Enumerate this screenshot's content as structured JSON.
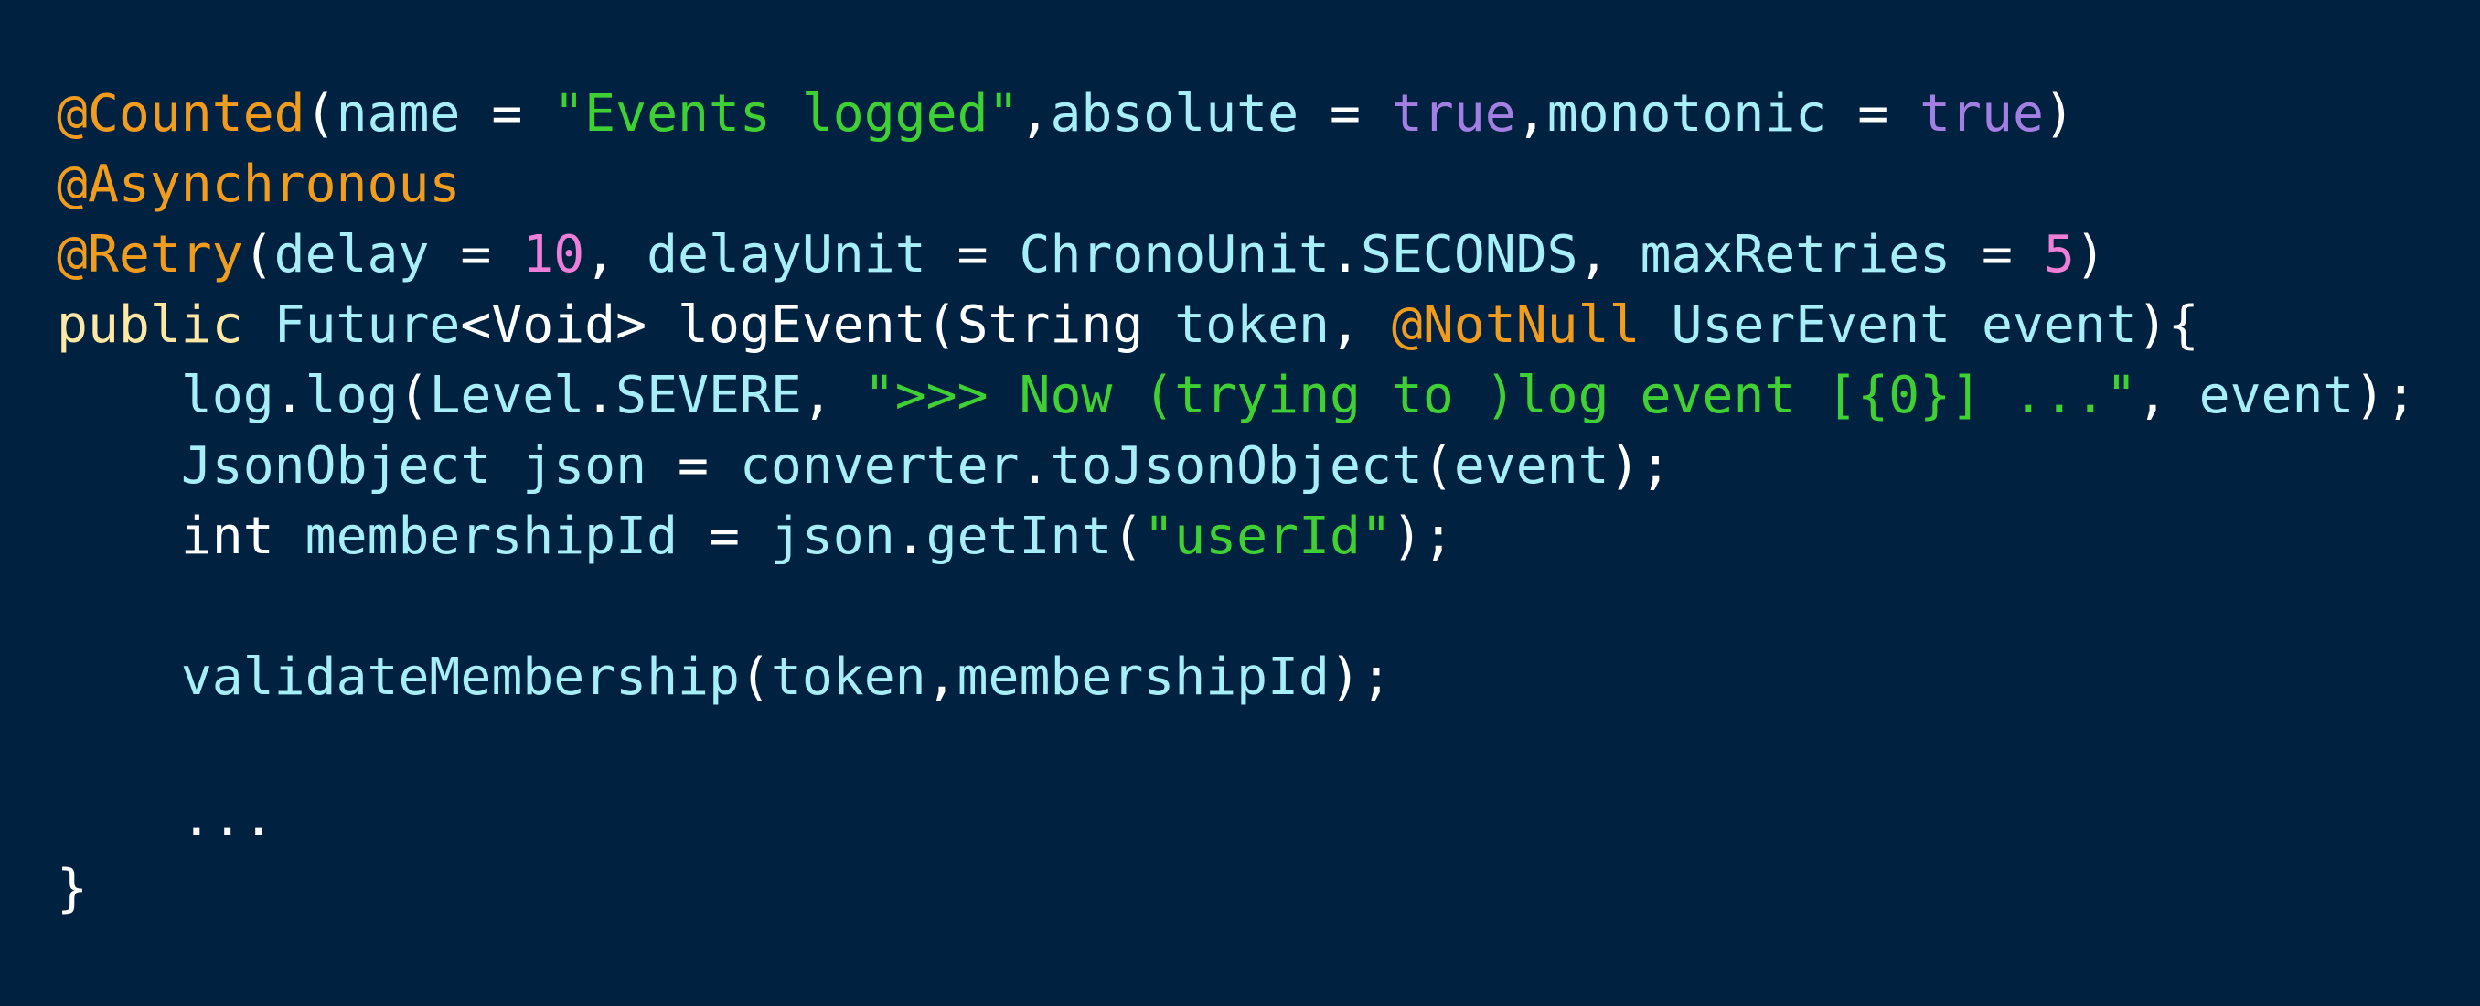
{
  "colors": {
    "background": "#00213f",
    "annotation": "#f29c1e",
    "string": "#3fd034",
    "boolean": "#a47fe3",
    "number": "#ee7fd9",
    "keyword": "#ffe8a3",
    "identifier": "#a6eef8",
    "punctuation": "#ffffff"
  },
  "code": {
    "lines": [
      [
        {
          "t": "@Counted",
          "k": "annotation"
        },
        {
          "t": "(",
          "k": "punct"
        },
        {
          "t": "name",
          "k": "ident"
        },
        {
          "t": " = ",
          "k": "punct"
        },
        {
          "t": "\"Events logged\"",
          "k": "string"
        },
        {
          "t": ",",
          "k": "punct"
        },
        {
          "t": "absolute",
          "k": "ident"
        },
        {
          "t": " = ",
          "k": "punct"
        },
        {
          "t": "true",
          "k": "boolean"
        },
        {
          "t": ",",
          "k": "punct"
        },
        {
          "t": "monotonic",
          "k": "ident"
        },
        {
          "t": " = ",
          "k": "punct"
        },
        {
          "t": "true",
          "k": "boolean"
        },
        {
          "t": ")",
          "k": "punct"
        }
      ],
      [
        {
          "t": "@Asynchronous",
          "k": "annotation"
        }
      ],
      [
        {
          "t": "@Retry",
          "k": "annotation"
        },
        {
          "t": "(",
          "k": "punct"
        },
        {
          "t": "delay",
          "k": "ident"
        },
        {
          "t": " = ",
          "k": "punct"
        },
        {
          "t": "10",
          "k": "number"
        },
        {
          "t": ", ",
          "k": "punct"
        },
        {
          "t": "delayUnit",
          "k": "ident"
        },
        {
          "t": " = ",
          "k": "punct"
        },
        {
          "t": "ChronoUnit",
          "k": "ident"
        },
        {
          "t": ".",
          "k": "punct"
        },
        {
          "t": "SECONDS",
          "k": "ident"
        },
        {
          "t": ", ",
          "k": "punct"
        },
        {
          "t": "maxRetries",
          "k": "ident"
        },
        {
          "t": " = ",
          "k": "punct"
        },
        {
          "t": "5",
          "k": "number"
        },
        {
          "t": ")",
          "k": "punct"
        }
      ],
      [
        {
          "t": "public",
          "k": "keyword"
        },
        {
          "t": " ",
          "k": "space"
        },
        {
          "t": "Future",
          "k": "ident"
        },
        {
          "t": "<Void> ",
          "k": "punct"
        },
        {
          "t": "logEvent",
          "k": "plain"
        },
        {
          "t": "(",
          "k": "punct"
        },
        {
          "t": "String",
          "k": "plain"
        },
        {
          "t": " ",
          "k": "space"
        },
        {
          "t": "token",
          "k": "ident"
        },
        {
          "t": ", ",
          "k": "punct"
        },
        {
          "t": "@NotNull",
          "k": "annotation"
        },
        {
          "t": " ",
          "k": "space"
        },
        {
          "t": "UserEvent",
          "k": "ident"
        },
        {
          "t": " ",
          "k": "space"
        },
        {
          "t": "event",
          "k": "ident"
        },
        {
          "t": "){",
          "k": "punct"
        }
      ],
      [
        {
          "t": "    ",
          "k": "space"
        },
        {
          "t": "log",
          "k": "ident"
        },
        {
          "t": ".",
          "k": "punct"
        },
        {
          "t": "log",
          "k": "ident"
        },
        {
          "t": "(",
          "k": "punct"
        },
        {
          "t": "Level",
          "k": "ident"
        },
        {
          "t": ".",
          "k": "punct"
        },
        {
          "t": "SEVERE",
          "k": "ident"
        },
        {
          "t": ", ",
          "k": "punct"
        },
        {
          "t": "\">>> Now (trying to )log event [{0}] ...\"",
          "k": "string"
        },
        {
          "t": ", ",
          "k": "punct"
        },
        {
          "t": "event",
          "k": "ident"
        },
        {
          "t": ");",
          "k": "punct"
        }
      ],
      [
        {
          "t": "    ",
          "k": "space"
        },
        {
          "t": "JsonObject",
          "k": "ident"
        },
        {
          "t": " ",
          "k": "space"
        },
        {
          "t": "json",
          "k": "ident"
        },
        {
          "t": " = ",
          "k": "punct"
        },
        {
          "t": "converter",
          "k": "ident"
        },
        {
          "t": ".",
          "k": "punct"
        },
        {
          "t": "toJsonObject",
          "k": "ident"
        },
        {
          "t": "(",
          "k": "punct"
        },
        {
          "t": "event",
          "k": "ident"
        },
        {
          "t": ");",
          "k": "punct"
        }
      ],
      [
        {
          "t": "    ",
          "k": "space"
        },
        {
          "t": "int",
          "k": "plain"
        },
        {
          "t": " ",
          "k": "space"
        },
        {
          "t": "membershipId",
          "k": "ident"
        },
        {
          "t": " = ",
          "k": "punct"
        },
        {
          "t": "json",
          "k": "ident"
        },
        {
          "t": ".",
          "k": "punct"
        },
        {
          "t": "getInt",
          "k": "ident"
        },
        {
          "t": "(",
          "k": "punct"
        },
        {
          "t": "\"userId\"",
          "k": "string"
        },
        {
          "t": ");",
          "k": "punct"
        }
      ],
      [],
      [
        {
          "t": "    ",
          "k": "space"
        },
        {
          "t": "validateMembership",
          "k": "ident"
        },
        {
          "t": "(",
          "k": "punct"
        },
        {
          "t": "token",
          "k": "ident"
        },
        {
          "t": ",",
          "k": "punct"
        },
        {
          "t": "membershipId",
          "k": "ident"
        },
        {
          "t": ");",
          "k": "punct"
        }
      ],
      [],
      [
        {
          "t": "    ",
          "k": "space"
        },
        {
          "t": "...",
          "k": "plain"
        }
      ],
      [
        {
          "t": "}",
          "k": "punct"
        }
      ]
    ]
  }
}
